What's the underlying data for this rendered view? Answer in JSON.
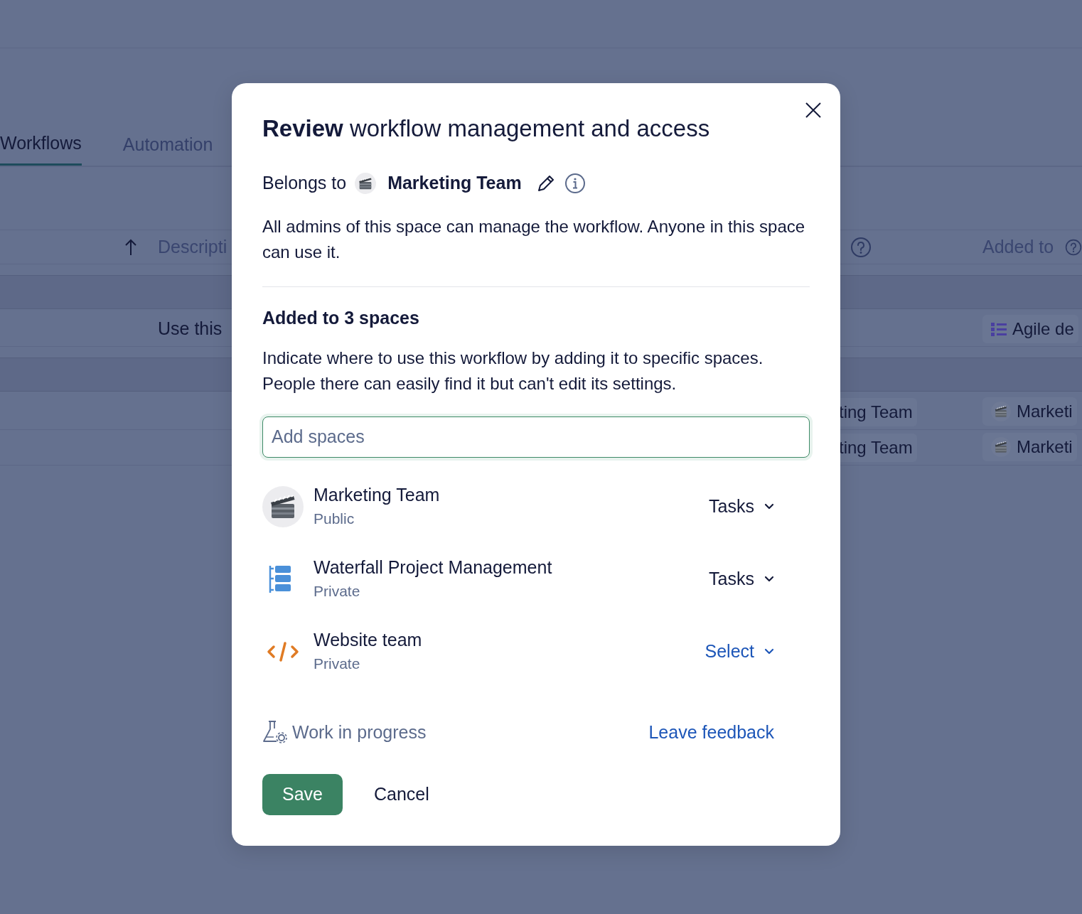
{
  "background": {
    "tabs": [
      {
        "label": "Workflows",
        "selected": true
      },
      {
        "label": "Automation",
        "selected": false
      }
    ],
    "table": {
      "header": {
        "column_3": "Descripti",
        "column_5": "Added to"
      },
      "rows": [
        {
          "kind": "group"
        },
        {
          "kind": "item",
          "column_3": "Use this",
          "column_5": {
            "kind": "list",
            "label": "Agile de"
          }
        },
        {
          "kind": "group"
        },
        {
          "kind": "item",
          "column_4": {
            "label": "ting Team"
          },
          "column_5": {
            "kind": "clapper",
            "label": "Marketi"
          }
        },
        {
          "kind": "item",
          "column_4": {
            "label": "ting Team"
          },
          "column_5": {
            "kind": "clapper",
            "label": "Marketi"
          }
        }
      ]
    }
  },
  "dialog": {
    "title": "**Review** workflow management and access",
    "belongs_label": "Belongs to",
    "owner": "Marketing Team",
    "owner_note": "All admins of this space can manage the workflow. Anyone in this space can use it.",
    "added_heading": "Added to 3 spaces",
    "added_note": "Indicate where to use this workflow by adding it to specific spaces. People there can easily find it but can't edit its settings.",
    "search": {
      "placeholder": "Add spaces"
    },
    "spaces": [
      {
        "kind": "clapper",
        "name": "Marketing Team",
        "visibility": "Public",
        "dropdown": {
          "value": "Tasks"
        }
      },
      {
        "kind": "waterfall",
        "name": "Waterfall Project Management",
        "visibility": "Private",
        "dropdown": {
          "value": "Tasks"
        }
      },
      {
        "kind": "code",
        "name": "Website team",
        "visibility": "Private",
        "dropdown": {
          "placeholder": "Select"
        }
      }
    ],
    "status": "Work in progress",
    "feedback_link": "Leave feedback",
    "buttons": [
      "Save",
      "Cancel"
    ]
  }
}
